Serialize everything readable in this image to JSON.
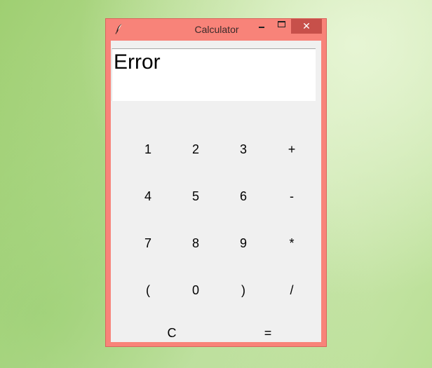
{
  "window": {
    "title": "Calculator",
    "close_glyph": "✕"
  },
  "display": {
    "value": "Error"
  },
  "keypad": {
    "rows": [
      [
        "1",
        "2",
        "3",
        "+"
      ],
      [
        "4",
        "5",
        "6",
        "-"
      ],
      [
        "7",
        "8",
        "9",
        "*"
      ],
      [
        "(",
        "0",
        ")",
        "/"
      ]
    ],
    "clear": "C",
    "equals": "="
  },
  "icons": {
    "app": "feather-icon",
    "minimize": "minimize-icon",
    "maximize": "maximize-icon",
    "close": "close-icon"
  },
  "colors": {
    "titlebar": "#f88379",
    "close_button": "#c7504a",
    "client_background": "#f0f0f0",
    "display_background": "#ffffff"
  }
}
